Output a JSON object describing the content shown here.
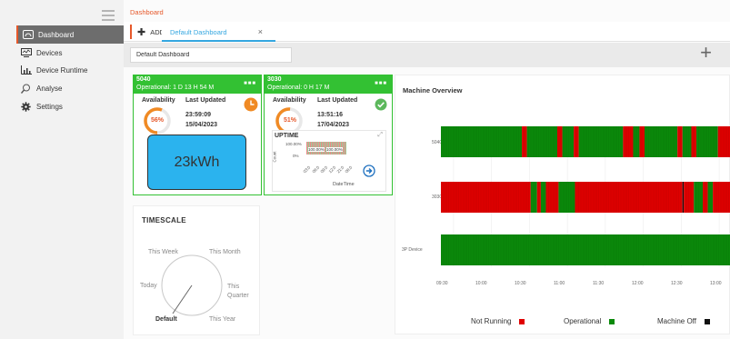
{
  "sidebar": {
    "items": [
      {
        "label": "Dashboard",
        "icon": "dashboard-icon",
        "active": true
      },
      {
        "label": "Devices",
        "icon": "devices-icon",
        "active": false
      },
      {
        "label": "Device Runtime",
        "icon": "device-runtime-icon",
        "active": false
      },
      {
        "label": "Analyse",
        "icon": "analyse-icon",
        "active": false
      },
      {
        "label": "Settings",
        "icon": "settings-icon",
        "active": false
      }
    ]
  },
  "breadcrumb": "Dashboard",
  "tabs": {
    "add_label": "ADD",
    "active_tab": "Default Dashboard",
    "close_glyph": "×"
  },
  "toolbar": {
    "dashboard_name_value": "Default Dashboard",
    "plus_glyph": "+"
  },
  "cards": [
    {
      "id": "5040",
      "status": "Operational: 1 D 13 H 54 M",
      "menu": "■■■",
      "availability_label": "Availability",
      "availability_pct": "56%",
      "availability_value": 56,
      "last_updated_label": "Last Updated",
      "last_updated_time": "23:59:09",
      "last_updated_date": "15/04/2023",
      "energy": "23kWh",
      "status_icon": "clock-icon"
    },
    {
      "id": "3030",
      "status": "Operational: 0 H 17 M",
      "menu": "■■■",
      "availability_label": "Availability",
      "availability_pct": "51%",
      "availability_value": 51,
      "last_updated_label": "Last Updated",
      "last_updated_time": "13:51:16",
      "last_updated_date": "17/04/2023",
      "status_icon": "check-icon",
      "uptime": {
        "title": "UPTIME",
        "y_label": "Count",
        "y_ticks": [
          "100.00%",
          "0%"
        ],
        "bar_labels": [
          "100.00%",
          "100.00%"
        ],
        "x_ticks": [
          "03:0",
          "06:0",
          "09:0",
          "12:0",
          "21:0",
          "06:0"
        ],
        "x_label": "DateTime"
      }
    }
  ],
  "timescale": {
    "title": "TIMESCALE",
    "options": [
      "This Week",
      "This Month",
      "Today",
      "This Quarter",
      "Default",
      "This Year"
    ],
    "selected": "Default"
  },
  "overview": {
    "title": "Machine Overview",
    "machines": [
      "5040",
      "3030",
      "3P Device"
    ],
    "x_ticks": [
      "09:30",
      "10:00",
      "10:30",
      "11:00",
      "11:30",
      "12:00",
      "12:30",
      "13:00"
    ],
    "legend": [
      {
        "label": "Not Running",
        "color": "#e00000"
      },
      {
        "label": "Operational",
        "color": "#0a8a0a"
      },
      {
        "label": "Machine Off",
        "color": "#111111"
      }
    ],
    "state_colors": {
      "operational": "#0a8a0a",
      "not_running": "#e00000",
      "off": "#111111"
    },
    "timeline_start": "09:20",
    "timeline_end": "13:10",
    "rows": [
      {
        "machine": "5040",
        "segments": [
          {
            "start": "09:20",
            "end": "10:24",
            "state": "operational"
          },
          {
            "start": "10:24",
            "end": "10:28",
            "state": "not_running"
          },
          {
            "start": "10:28",
            "end": "10:52",
            "state": "operational"
          },
          {
            "start": "10:52",
            "end": "10:56",
            "state": "not_running"
          },
          {
            "start": "10:56",
            "end": "11:05",
            "state": "operational"
          },
          {
            "start": "11:05",
            "end": "11:09",
            "state": "not_running"
          },
          {
            "start": "11:09",
            "end": "11:44",
            "state": "operational"
          },
          {
            "start": "11:44",
            "end": "11:52",
            "state": "not_running"
          },
          {
            "start": "11:52",
            "end": "11:57",
            "state": "operational"
          },
          {
            "start": "11:57",
            "end": "12:01",
            "state": "not_running"
          },
          {
            "start": "12:01",
            "end": "12:27",
            "state": "operational"
          },
          {
            "start": "12:27",
            "end": "12:31",
            "state": "not_running"
          },
          {
            "start": "12:31",
            "end": "12:38",
            "state": "operational"
          },
          {
            "start": "12:38",
            "end": "12:42",
            "state": "not_running"
          },
          {
            "start": "12:42",
            "end": "12:59",
            "state": "operational"
          },
          {
            "start": "12:59",
            "end": "13:10",
            "state": "not_running"
          }
        ]
      },
      {
        "machine": "3030",
        "segments": [
          {
            "start": "09:20",
            "end": "10:31",
            "state": "not_running"
          },
          {
            "start": "10:31",
            "end": "10:36",
            "state": "operational"
          },
          {
            "start": "10:36",
            "end": "10:39",
            "state": "not_running"
          },
          {
            "start": "10:39",
            "end": "10:43",
            "state": "operational"
          },
          {
            "start": "10:43",
            "end": "10:53",
            "state": "not_running"
          },
          {
            "start": "10:53",
            "end": "11:06",
            "state": "operational"
          },
          {
            "start": "11:06",
            "end": "12:31",
            "state": "not_running"
          },
          {
            "start": "12:31",
            "end": "12:32",
            "state": "off"
          },
          {
            "start": "12:32",
            "end": "12:40",
            "state": "not_running"
          },
          {
            "start": "12:40",
            "end": "12:47",
            "state": "operational"
          },
          {
            "start": "12:47",
            "end": "12:51",
            "state": "not_running"
          },
          {
            "start": "12:51",
            "end": "12:55",
            "state": "operational"
          },
          {
            "start": "12:55",
            "end": "13:10",
            "state": "not_running"
          }
        ]
      },
      {
        "machine": "3P Device",
        "segments": [
          {
            "start": "09:20",
            "end": "13:10",
            "state": "operational"
          }
        ]
      }
    ]
  },
  "colors": {
    "accent": "#e6582a",
    "card_green": "#33c133",
    "tab_blue": "#35a7e0",
    "gauge_orange": "#f08a24",
    "energy_blue": "#2bb3ee"
  }
}
